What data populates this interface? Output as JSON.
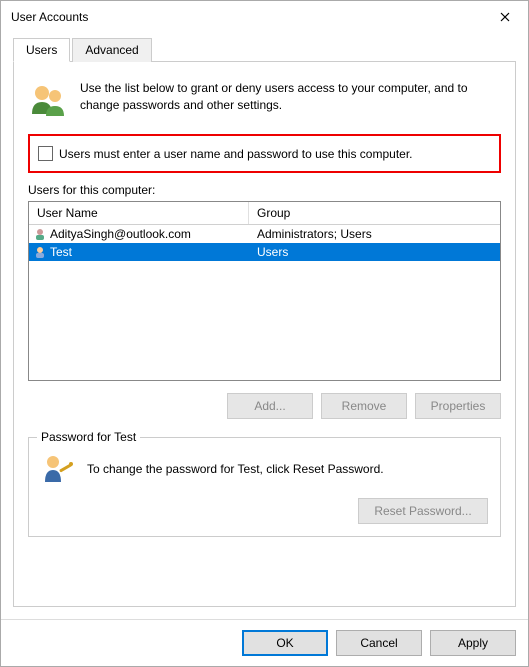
{
  "window": {
    "title": "User Accounts"
  },
  "tabs": {
    "users": "Users",
    "advanced": "Advanced"
  },
  "intro": "Use the list below to grant or deny users access to your computer, and to change passwords and other settings.",
  "checkbox": {
    "label": "Users must enter a user name and password to use this computer."
  },
  "usersLabel": "Users for this computer:",
  "columns": {
    "name": "User Name",
    "group": "Group"
  },
  "rows": [
    {
      "name": "AdityaSingh@outlook.com",
      "group": "Administrators; Users"
    },
    {
      "name": "Test",
      "group": "Users"
    }
  ],
  "buttons": {
    "add": "Add...",
    "remove": "Remove",
    "properties": "Properties"
  },
  "pw": {
    "groupTitle": "Password for Test",
    "text": "To change the password for Test, click Reset Password.",
    "reset": "Reset Password..."
  },
  "footer": {
    "ok": "OK",
    "cancel": "Cancel",
    "apply": "Apply"
  }
}
